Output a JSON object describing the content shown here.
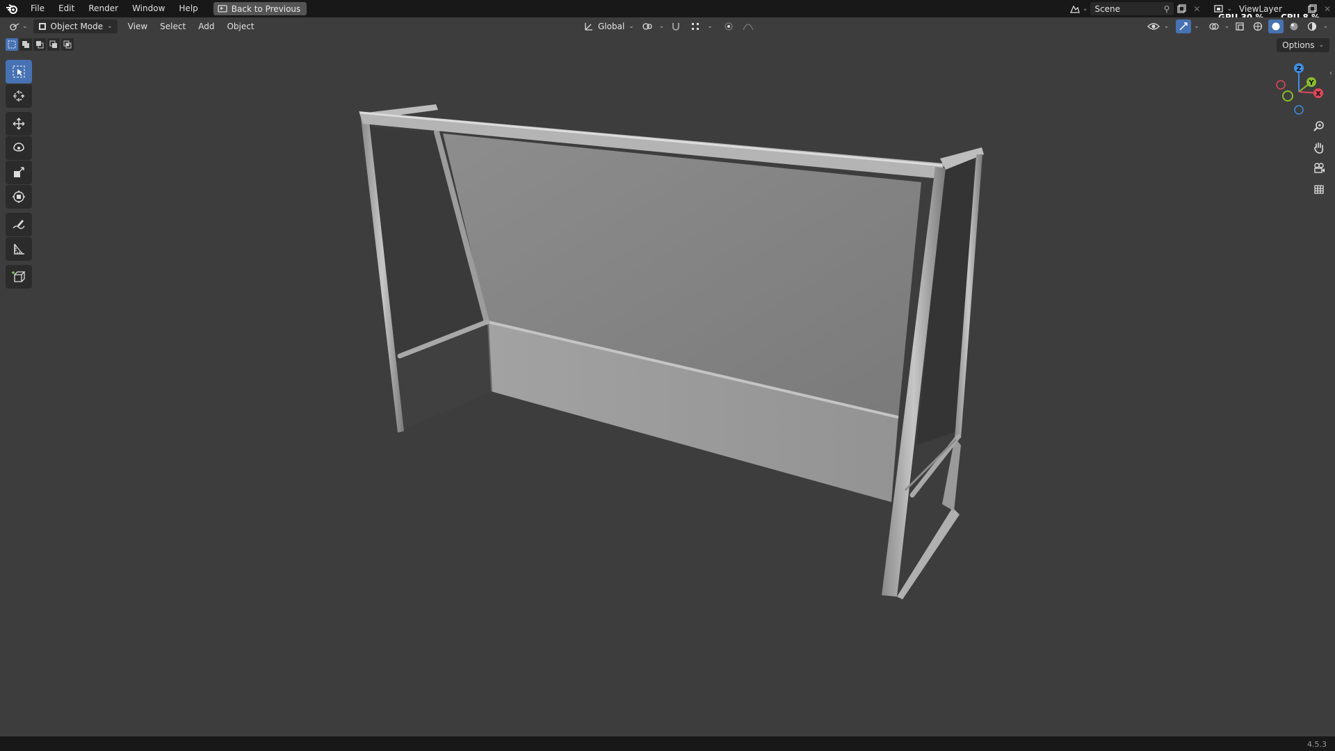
{
  "menubar": {
    "items": [
      "File",
      "Edit",
      "Render",
      "Window",
      "Help"
    ],
    "back_label": "Back to Previous",
    "scene_name": "Scene",
    "view_layer": "ViewLayer",
    "gpu_stat": "GPU 30 %",
    "cpu_stat": "CPU  8 %"
  },
  "header": {
    "mode": "Object Mode",
    "menus": [
      "View",
      "Select",
      "Add",
      "Object"
    ],
    "transform_orientation": "Global",
    "options_label": "Options"
  },
  "gizmo": {
    "z_label": "Z",
    "y_label": "Y",
    "x_label": "X",
    "colors": {
      "x": "#e0485a",
      "y": "#8bbb2e",
      "z": "#3f8fe6"
    }
  },
  "status": {
    "version": "4.5.3"
  },
  "colors": {
    "accent": "#4772b3",
    "viewport_bg": "#3d3d3d",
    "topbar_bg": "#181818"
  }
}
